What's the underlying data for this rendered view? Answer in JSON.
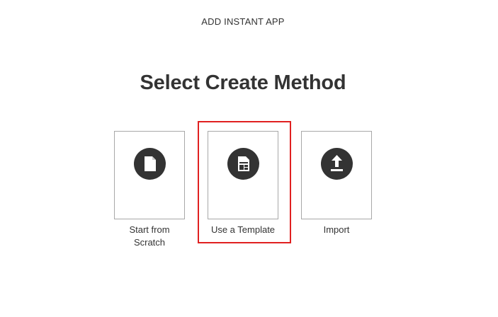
{
  "header": {
    "title": "ADD INSTANT APP"
  },
  "main": {
    "title": "Select Create Method",
    "methods": [
      {
        "label": "Start from Scratch",
        "icon": "document-icon"
      },
      {
        "label": "Use a Template",
        "icon": "template-icon",
        "selected": true
      },
      {
        "label": "Import",
        "icon": "upload-icon"
      }
    ]
  },
  "colors": {
    "text": "#333333",
    "icon_background": "#333333",
    "card_border": "#a8a8a8",
    "highlight": "#e02020"
  }
}
